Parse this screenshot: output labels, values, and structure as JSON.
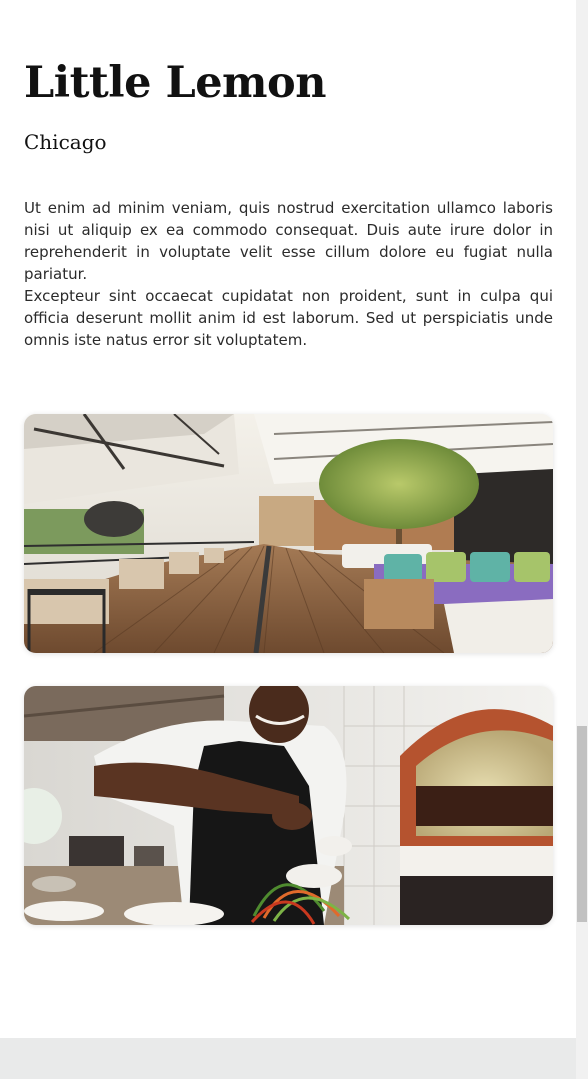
{
  "header": {
    "title": "Little Lemon",
    "subtitle": "Chicago"
  },
  "about": {
    "paragraph_1": "Ut enim ad minim veniam, quis nostrud exercitation ullamco laboris nisi ut aliquip ex ea commodo consequat. Duis aute irure dolor in reprehenderit in voluptate velit esse cillum dolore eu fugiat nulla pariatur.",
    "paragraph_2": "Excepteur sint occaecat cupidatat non proident, sunt in culpa qui officia deserunt mollit anim id est laborum. Sed ut perspiciatis unde omnis iste natus error sit voluptatem."
  },
  "images": [
    {
      "subject": "restaurant-terrace"
    },
    {
      "subject": "chef-plating-salad"
    }
  ],
  "scrollbar": {
    "position": 0.67
  },
  "colors": {
    "text": "#111111",
    "body_text": "#2b2b2b",
    "footer_band": "#e9eaea",
    "scroll_thumb": "#c1c1c1"
  }
}
